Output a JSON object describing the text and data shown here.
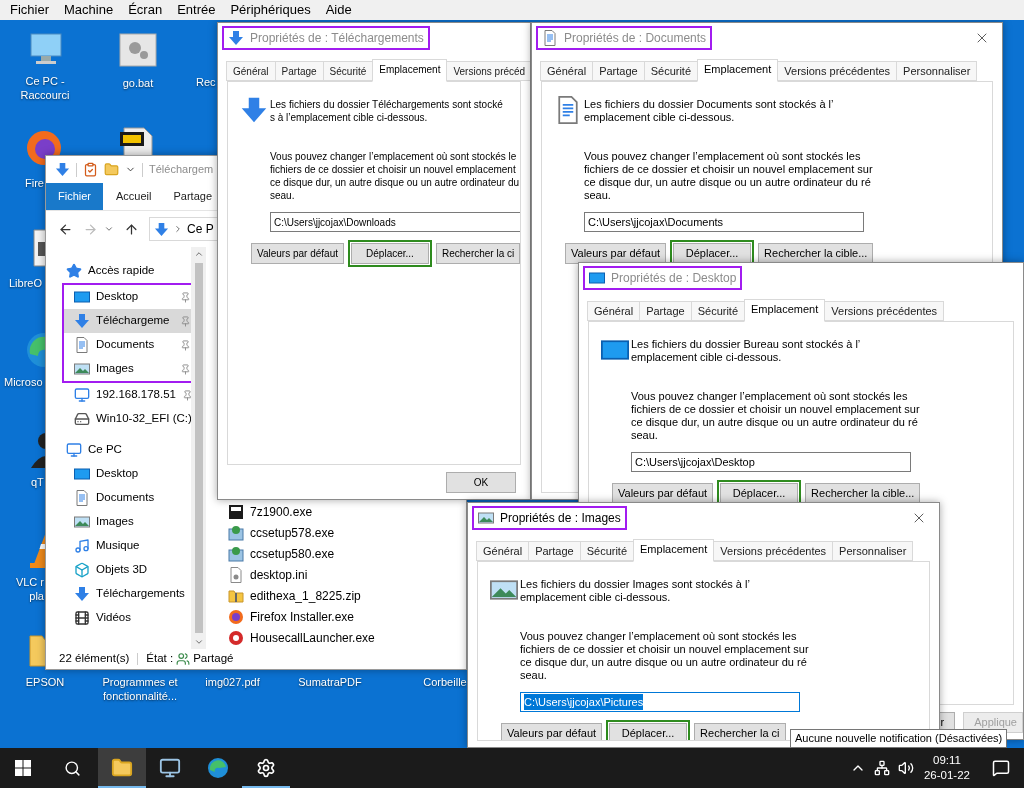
{
  "menu_bar": [
    "Fichier",
    "Machine",
    "Écran",
    "Entrée",
    "Périphériques",
    "Aide"
  ],
  "desktop_icons": [
    {
      "kind": "computer",
      "lines": [
        "Ce PC -",
        "Raccourci"
      ]
    },
    {
      "kind": "gear-file",
      "lines": [
        "go.bat"
      ]
    },
    {
      "kind": "none",
      "lines": [
        "Rec"
      ]
    },
    {
      "kind": "firefox",
      "lines": [
        "Fire"
      ]
    },
    {
      "kind": "pdf"
    },
    {
      "kind": "document",
      "lines": [
        "LibreO"
      ]
    },
    {
      "kind": "edge",
      "lines": [
        "Microso"
      ]
    },
    {
      "kind": "person",
      "lines": [
        "qT"
      ]
    },
    {
      "kind": "cone",
      "lines": [
        "VLC r",
        "pla"
      ]
    },
    {
      "kind": "folder",
      "lines": [
        "EPSON"
      ]
    },
    {
      "kind": "none",
      "lines": [
        "Programmes et",
        "fonctionnalité..."
      ]
    },
    {
      "kind": "none",
      "lines": [
        "img027.pdf"
      ]
    },
    {
      "kind": "none",
      "lines": [
        "SumatraPDF"
      ]
    },
    {
      "kind": "none",
      "lines": [
        "Corbeille"
      ]
    }
  ],
  "explorer": {
    "title": "Téléchargem",
    "ribbon_tabs": [
      {
        "label": "Fichier",
        "selected": true
      },
      {
        "label": "Accueil",
        "selected": false
      },
      {
        "label": "Partage",
        "selected": false
      }
    ],
    "address": "Ce P",
    "nav": [
      {
        "label": "Accès rapide",
        "kind": "quick-access",
        "children": [
          {
            "label": "Desktop",
            "kind": "desktop",
            "pinned": true,
            "selected": false,
            "annotated": true
          },
          {
            "label": "Téléchargeme",
            "kind": "download",
            "pinned": true,
            "selected": true,
            "annotated": true
          },
          {
            "label": "Documents",
            "kind": "document",
            "pinned": true,
            "selected": false,
            "annotated": true
          },
          {
            "label": "Images",
            "kind": "image",
            "pinned": true,
            "selected": false,
            "annotated": true
          },
          {
            "label": "192.168.178.51",
            "kind": "network-computer",
            "pinned": true,
            "selected": false,
            "annotated": false
          },
          {
            "label": "Win10-32_EFI (C:)",
            "kind": "drive",
            "pinned": false,
            "selected": false,
            "annotated": false
          }
        ]
      },
      {
        "label": "Ce PC",
        "kind": "computer",
        "children": [
          {
            "label": "Desktop",
            "kind": "desktop",
            "pinned": false,
            "selected": false,
            "annotated": false
          },
          {
            "label": "Documents",
            "kind": "document",
            "pinned": false,
            "selected": false,
            "annotated": false
          },
          {
            "label": "Images",
            "kind": "image",
            "pinned": false,
            "selected": false,
            "annotated": false
          },
          {
            "label": "Musique",
            "kind": "music",
            "pinned": false,
            "selected": false,
            "annotated": false
          },
          {
            "label": "Objets 3D",
            "kind": "cube",
            "pinned": false,
            "selected": false,
            "annotated": false
          },
          {
            "label": "Téléchargements",
            "kind": "download",
            "pinned": false,
            "selected": false,
            "annotated": false
          },
          {
            "label": "Vidéos",
            "kind": "video",
            "pinned": false,
            "selected": false,
            "annotated": false
          }
        ]
      }
    ],
    "files": [
      {
        "name": "7z1900.exe",
        "kind": "archive-app"
      },
      {
        "name": "ccsetup578.exe",
        "kind": "installer"
      },
      {
        "name": "ccsetup580.exe",
        "kind": "installer"
      },
      {
        "name": "desktop.ini",
        "kind": "settings-file"
      },
      {
        "name": "edithexa_1_8225.zip",
        "kind": "zip"
      },
      {
        "name": "Firefox Installer.exe",
        "kind": "firefox"
      },
      {
        "name": "HousecallLauncher.exe",
        "kind": "launcher"
      }
    ],
    "status": {
      "count": "22 élément(s)",
      "state_label": "État :",
      "state_value": "Partagé"
    }
  },
  "dialogs": [
    {
      "title": "Propriétés de : Téléchargements",
      "kind": "download",
      "active": false,
      "title_annotated": true,
      "closable": false,
      "tabs": [
        {
          "label": "Général",
          "selected": false
        },
        {
          "label": "Partage",
          "selected": false
        },
        {
          "label": "Sécurité",
          "selected": false
        },
        {
          "label": "Emplacement",
          "selected": true
        },
        {
          "label": "Versions précéd",
          "selected": false
        }
      ],
      "intro_lines": [
        "Les fichiers du dossier Téléchargements sont stocké",
        "s à l’emplacement cible ci-dessous."
      ],
      "body_lines": [
        "Vous pouvez changer l’emplacement où sont stockés le",
        "fichiers de ce dossier et choisir un nouvel emplacement",
        "ce disque dur, un autre disque ou un autre ordinateur du",
        "seau."
      ],
      "path": "C:\\Users\\jjcojax\\Downloads",
      "path_selected": false,
      "buttons": [
        {
          "label": "Valeurs par défaut",
          "annotated": false
        },
        {
          "label": "Déplacer...",
          "annotated": true
        },
        {
          "label": "Rechercher la ci",
          "annotated": false
        }
      ],
      "footer_buttons": [
        {
          "label": "OK",
          "disabled": false
        }
      ]
    },
    {
      "title": "Propriétés de : Documents",
      "kind": "document",
      "active": false,
      "title_annotated": true,
      "closable": true,
      "tabs": [
        {
          "label": "Général",
          "selected": false
        },
        {
          "label": "Partage",
          "selected": false
        },
        {
          "label": "Sécurité",
          "selected": false
        },
        {
          "label": "Emplacement",
          "selected": true
        },
        {
          "label": "Versions précédentes",
          "selected": false
        },
        {
          "label": "Personnaliser",
          "selected": false
        }
      ],
      "intro_lines": [
        "Les fichiers du dossier Documents sont stockés à l’",
        "emplacement cible ci-dessous."
      ],
      "body_lines": [
        "Vous pouvez changer l’emplacement où sont stockés les",
        "fichiers de ce dossier et choisir un nouvel emplacement sur",
        "ce disque dur, un autre disque ou un autre ordinateur du ré",
        "seau."
      ],
      "path": "C:\\Users\\jjcojax\\Documents",
      "path_selected": false,
      "buttons": [
        {
          "label": "Valeurs par défaut",
          "annotated": false
        },
        {
          "label": "Déplacer...",
          "annotated": true
        },
        {
          "label": "Rechercher la cible...",
          "annotated": false
        }
      ]
    },
    {
      "title": "Propriétés de : Desktop",
      "kind": "desktop",
      "active": false,
      "title_annotated": true,
      "closable": false,
      "tabs": [
        {
          "label": "Général",
          "selected": false
        },
        {
          "label": "Partage",
          "selected": false
        },
        {
          "label": "Sécurité",
          "selected": false
        },
        {
          "label": "Emplacement",
          "selected": true
        },
        {
          "label": "Versions précédentes",
          "selected": false
        }
      ],
      "intro_lines": [
        "Les fichiers du dossier Bureau sont stockés à l’",
        "emplacement cible ci-dessous."
      ],
      "body_lines": [
        "Vous pouvez changer l’emplacement où sont stockés les",
        "fichiers de ce dossier et choisir un nouvel emplacement sur",
        "ce disque dur, un autre disque ou un autre ordinateur du ré",
        "seau."
      ],
      "path": "C:\\Users\\jjcojax\\Desktop",
      "path_selected": false,
      "buttons": [
        {
          "label": "Valeurs par défaut",
          "annotated": false
        },
        {
          "label": "Déplacer...",
          "annotated": true
        },
        {
          "label": "Rechercher la cible...",
          "annotated": false
        }
      ],
      "footer_buttons": [
        {
          "label": "r",
          "disabled": false
        },
        {
          "label": "Applique",
          "disabled": true
        }
      ]
    },
    {
      "title": "Propriétés de : Images",
      "kind": "image",
      "active": true,
      "title_annotated": true,
      "closable": true,
      "tabs": [
        {
          "label": "Général",
          "selected": false
        },
        {
          "label": "Partage",
          "selected": false
        },
        {
          "label": "Sécurité",
          "selected": false
        },
        {
          "label": "Emplacement",
          "selected": true
        },
        {
          "label": "Versions précédentes",
          "selected": false
        },
        {
          "label": "Personnaliser",
          "selected": false
        }
      ],
      "intro_lines": [
        "Les fichiers du dossier Images sont stockés à l’",
        "emplacement cible ci-dessous."
      ],
      "body_lines": [
        "Vous pouvez changer l’emplacement où sont stockés les",
        "fichiers de ce dossier et choisir un nouvel emplacement sur",
        "ce disque dur, un autre disque ou un autre ordinateur du ré",
        "seau."
      ],
      "path": "C:\\Users\\jjcojax\\Pictures",
      "path_selected": true,
      "buttons": [
        {
          "label": "Valeurs par défaut",
          "annotated": false
        },
        {
          "label": "Déplacer...",
          "annotated": true
        },
        {
          "label": "Rechercher la ci",
          "annotated": false
        }
      ]
    }
  ],
  "tooltip": "Aucune nouvelle notification (Désactivées)",
  "taskbar": {
    "apps": [
      {
        "kind": "explorer",
        "open": true,
        "focused": true
      },
      {
        "kind": "remote",
        "open": false,
        "focused": false
      },
      {
        "kind": "edge",
        "open": false,
        "focused": false
      },
      {
        "kind": "settings",
        "open": true,
        "focused": false
      }
    ],
    "time": "09:11",
    "date": "26-01-22"
  }
}
